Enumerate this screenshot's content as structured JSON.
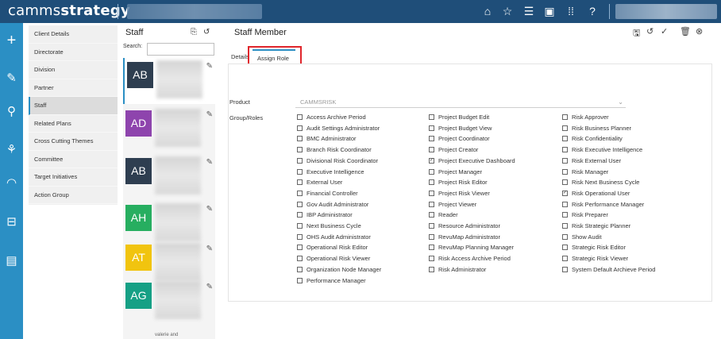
{
  "app": {
    "logo_light": "camms",
    "logo_bold": "strategy"
  },
  "menu": {
    "items": [
      {
        "label": "Client Details",
        "active": false
      },
      {
        "label": "Directorate",
        "active": false
      },
      {
        "label": "Division",
        "active": false
      },
      {
        "label": "Partner",
        "active": false
      },
      {
        "label": "Staff",
        "active": true
      },
      {
        "label": "Related Plans",
        "active": false
      },
      {
        "label": "Cross Cutting Themes",
        "active": false
      },
      {
        "label": "Committee",
        "active": false
      },
      {
        "label": "Target Initiatives",
        "active": false
      },
      {
        "label": "Action Group",
        "active": false
      }
    ]
  },
  "staff": {
    "title": "Staff",
    "search_label": "Search:",
    "search_value": "",
    "cards": [
      {
        "initials": "AB",
        "color": "#2e3e50"
      },
      {
        "initials": "AD",
        "color": "#8e44ad"
      },
      {
        "initials": "AB",
        "color": "#2e3e50"
      },
      {
        "initials": "AH",
        "color": "#27ae60"
      },
      {
        "initials": "AT",
        "color": "#f1c40f"
      },
      {
        "initials": "AG",
        "color": "#16a085"
      }
    ],
    "footer_text": "valerie and"
  },
  "main": {
    "title": "Staff Member",
    "tabs": [
      {
        "label": "Details"
      },
      {
        "label": "Assign Role"
      }
    ],
    "product_label": "Product",
    "product_value": "CAMMSRISK",
    "group_roles_label": "Group/Roles"
  },
  "roles": {
    "col1": [
      {
        "label": "Access Archive Period",
        "checked": false
      },
      {
        "label": "Audit Settings Administrator",
        "checked": false
      },
      {
        "label": "BMC Administrator",
        "checked": false
      },
      {
        "label": "Branch Risk Coordinator",
        "checked": false
      },
      {
        "label": "Divisional Risk Coordinator",
        "checked": false
      },
      {
        "label": "Executive Intelligence",
        "checked": false
      },
      {
        "label": "External User",
        "checked": false
      },
      {
        "label": "Financial Controller",
        "checked": false
      },
      {
        "label": "Gov Audit Administrator",
        "checked": false
      },
      {
        "label": "IBP Administrator",
        "checked": false
      },
      {
        "label": "Next Business Cycle",
        "checked": false
      },
      {
        "label": "OHS Audit Administrator",
        "checked": false
      },
      {
        "label": "Operational Risk Editor",
        "checked": false
      },
      {
        "label": "Operational Risk Viewer",
        "checked": false
      },
      {
        "label": "Organization Node Manager",
        "checked": false
      },
      {
        "label": "Performance Manager",
        "checked": false
      }
    ],
    "col2": [
      {
        "label": "Project Budget Edit",
        "checked": false
      },
      {
        "label": "Project Budget View",
        "checked": false
      },
      {
        "label": "Project Coordinator",
        "checked": false
      },
      {
        "label": "Project Creator",
        "checked": false
      },
      {
        "label": "Project Executive Dashboard",
        "checked": true
      },
      {
        "label": "Project Manager",
        "checked": false
      },
      {
        "label": "Project Risk Editor",
        "checked": false
      },
      {
        "label": "Project Risk Viewer",
        "checked": false
      },
      {
        "label": "Project Viewer",
        "checked": false
      },
      {
        "label": "Reader",
        "checked": false
      },
      {
        "label": "Resource Administrator",
        "checked": false
      },
      {
        "label": "RevuMap Administrator",
        "checked": false
      },
      {
        "label": "RevuMap Planning Manager",
        "checked": false
      },
      {
        "label": "Risk Access Archive Period",
        "checked": false
      },
      {
        "label": "Risk Administrator",
        "checked": false
      }
    ],
    "col3": [
      {
        "label": "Risk Approver",
        "checked": false
      },
      {
        "label": "Risk Business Planner",
        "checked": false
      },
      {
        "label": "Risk Confidentiality",
        "checked": false
      },
      {
        "label": "Risk Executive Intelligence",
        "checked": false
      },
      {
        "label": "Risk External User",
        "checked": false
      },
      {
        "label": "Risk Manager",
        "checked": false
      },
      {
        "label": "Risk Next Business Cycle",
        "checked": false
      },
      {
        "label": "Risk Operational User",
        "checked": true
      },
      {
        "label": "Risk Performance Manager",
        "checked": false
      },
      {
        "label": "Risk Preparer",
        "checked": false
      },
      {
        "label": "Risk Strategic Planner",
        "checked": false
      },
      {
        "label": "Show Audit",
        "checked": false
      },
      {
        "label": "Strategic Risk Editor",
        "checked": false
      },
      {
        "label": "Strategic Risk Viewer",
        "checked": false
      },
      {
        "label": "System Default Archieve Period",
        "checked": false
      }
    ]
  },
  "colors": {
    "topbar": "#1f4e79",
    "rail": "#2b8fc4",
    "highlight": "#e0262c"
  }
}
